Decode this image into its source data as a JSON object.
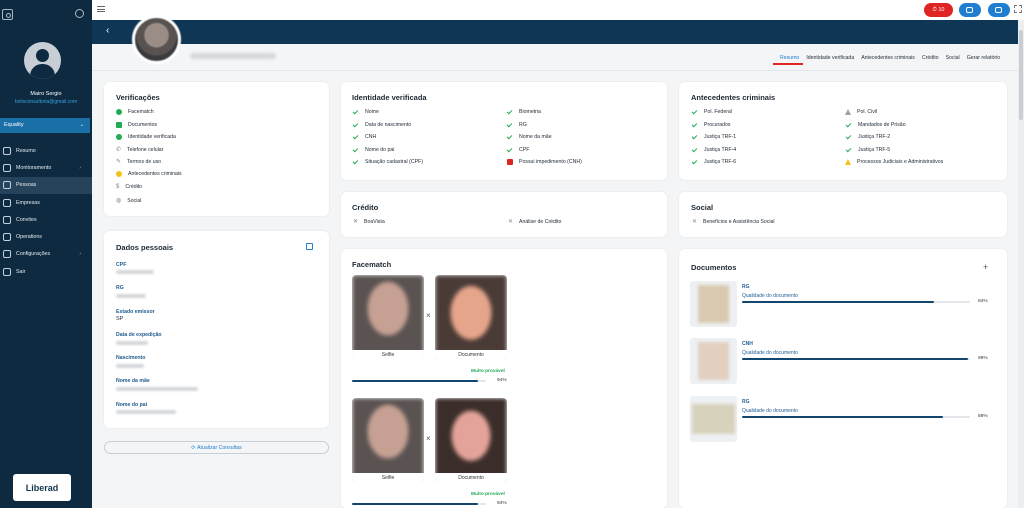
{
  "sidebar": {
    "user_name": "Mairo Sergio",
    "user_email": "bolisconsultoria@gmail.com",
    "company": "Equality",
    "items": [
      {
        "label": "Resumo",
        "icon": "clock-icon"
      },
      {
        "label": "Monitoramento",
        "icon": "globe-icon",
        "has_submenu": true
      },
      {
        "label": "Pessoas",
        "icon": "people-icon",
        "active": true
      },
      {
        "label": "Empresas",
        "icon": "building-icon"
      },
      {
        "label": "Convites",
        "icon": "invite-icon"
      },
      {
        "label": "Operations",
        "icon": "operations-icon"
      },
      {
        "label": "Configurações",
        "icon": "gear-icon",
        "has_submenu": true
      },
      {
        "label": "Sair",
        "icon": "logout-icon"
      }
    ],
    "logo_text": "Liberad"
  },
  "topbar": {
    "alert_count": "10"
  },
  "profile": {
    "tabs": [
      "Resumo",
      "Identidade verificada",
      "Antecedentes criminais",
      "Crédito",
      "Social",
      "Gerar relatório"
    ],
    "active_tab": "Resumo"
  },
  "verificacoes": {
    "title": "Verificações",
    "items": [
      "Facematch",
      "Documentos",
      "Identidade verificada",
      "Telefone celular",
      "Termos de uso",
      "Antecedentes criminais",
      "Crédito",
      "Social"
    ]
  },
  "dados": {
    "title": "Dados pessoais",
    "fields": [
      {
        "label": "CPF",
        "value": ""
      },
      {
        "label": "RG",
        "value": ""
      },
      {
        "label": "Estado emissor",
        "value": "SP"
      },
      {
        "label": "Data de expedição",
        "value": ""
      },
      {
        "label": "Nascimento",
        "value": ""
      },
      {
        "label": "Nome da mãe",
        "value": ""
      },
      {
        "label": "Nome do pai",
        "value": ""
      }
    ],
    "update_button": "Atualizar Consultas"
  },
  "identidade": {
    "title": "Identidade verificada",
    "left": [
      "Nome",
      "Data de nascimento",
      "CNH",
      "Nome do pai",
      "Situação cadastral (CPF)"
    ],
    "right": [
      "Biometria",
      "RG",
      "Nome da mãe",
      "CPF",
      "Possui impedimento (CNH)"
    ]
  },
  "antecedentes": {
    "title": "Antecedentes criminais",
    "left": [
      "Pol. Federal",
      "Procurados",
      "Justiça TRF-1",
      "Justiça TRF-4",
      "Justiça TRF-6"
    ],
    "right": [
      "Pol. Civil",
      "Mandados de Prisão",
      "Justiça TRF-2",
      "Justiça TRF-5",
      "Processos Judiciais e Administrativos"
    ]
  },
  "credito": {
    "title": "Crédito",
    "items": [
      "BoaVista",
      "Análise de Crédito"
    ]
  },
  "social": {
    "title": "Social",
    "items": [
      "Benefícios e Assistência Social"
    ]
  },
  "facematch": {
    "title": "Facematch",
    "pairs": [
      {
        "left_caption": "Selfie",
        "right_caption": "Documento",
        "result": "Muito provável",
        "percent_text": "94%",
        "percent": 94
      },
      {
        "left_caption": "Selfie",
        "right_caption": "Documento",
        "result": "Muito provável",
        "percent_text": "94%",
        "percent": 94
      }
    ]
  },
  "documentos": {
    "title": "Documentos",
    "items": [
      {
        "type": "RG",
        "quality_label": "Qualidade do documento",
        "percent_text": "84%",
        "percent": 84
      },
      {
        "type": "CNH",
        "quality_label": "Qualidade do documento",
        "percent_text": "99%",
        "percent": 99
      },
      {
        "type": "RG",
        "quality_label": "Qualidade do documento",
        "percent_text": "88%",
        "percent": 88
      }
    ]
  },
  "colors": {
    "primary": "#0f3655",
    "accent": "#1f7ed0",
    "success": "#22aa55",
    "danger": "#e02424",
    "warning": "#f2c21b"
  }
}
